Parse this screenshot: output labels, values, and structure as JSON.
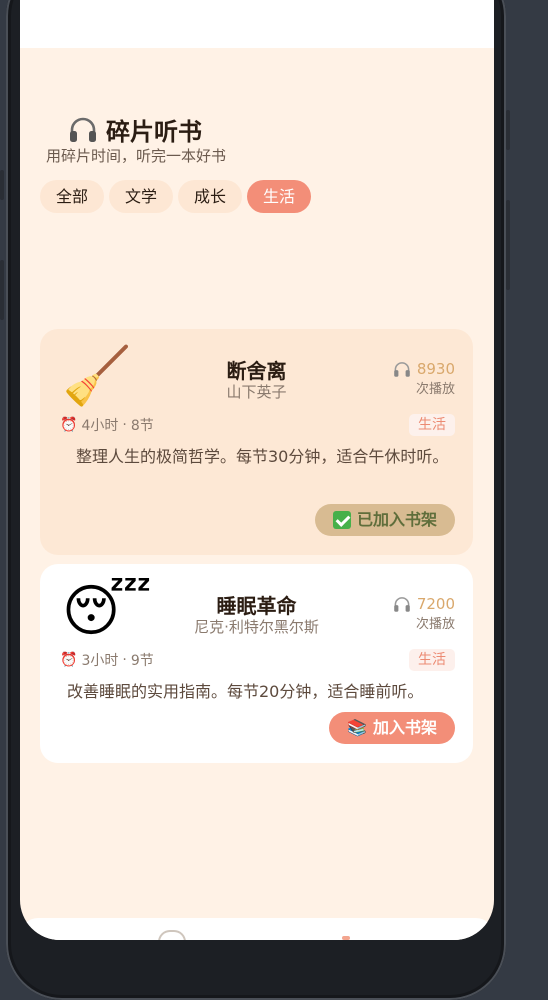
{
  "app": {
    "title": "碎片听书",
    "subtitle": "用碎片时间，听完一本好书",
    "title_icon": "headphones-icon"
  },
  "tabs": [
    {
      "label": "全部",
      "active": false
    },
    {
      "label": "文学",
      "active": false
    },
    {
      "label": "成长",
      "active": false
    },
    {
      "label": "生活",
      "active": true
    }
  ],
  "books": [
    {
      "cover_icon": "broom-emoji",
      "cover_glyph": "🧹",
      "title": "断舍离",
      "author": "山下英子",
      "plays": "8930",
      "plays_label": "次播放",
      "duration": "4小时",
      "sections": "8节",
      "category": "生活",
      "description": "整理人生的极简哲学。每节30分钟，适合午休时听。",
      "shelf_label": "已加入书架",
      "on_shelf": true
    },
    {
      "cover_icon": "sleeping-face-emoji",
      "cover_glyph": "😴",
      "title": "睡眠革命",
      "author": "尼克·利特尔黑尔斯",
      "plays": "7200",
      "plays_label": "次播放",
      "duration": "3小时",
      "sections": "9节",
      "category": "生活",
      "description": "改善睡眠的实用指南。每节20分钟，适合睡前听。",
      "shelf_label": "加入书架",
      "shelf_glyph": "📚",
      "on_shelf": false
    }
  ],
  "colors": {
    "background": "#fff2e6",
    "accent": "#f38e78",
    "tab_bg": "#fde7d4",
    "plays": "#d9a86c"
  }
}
